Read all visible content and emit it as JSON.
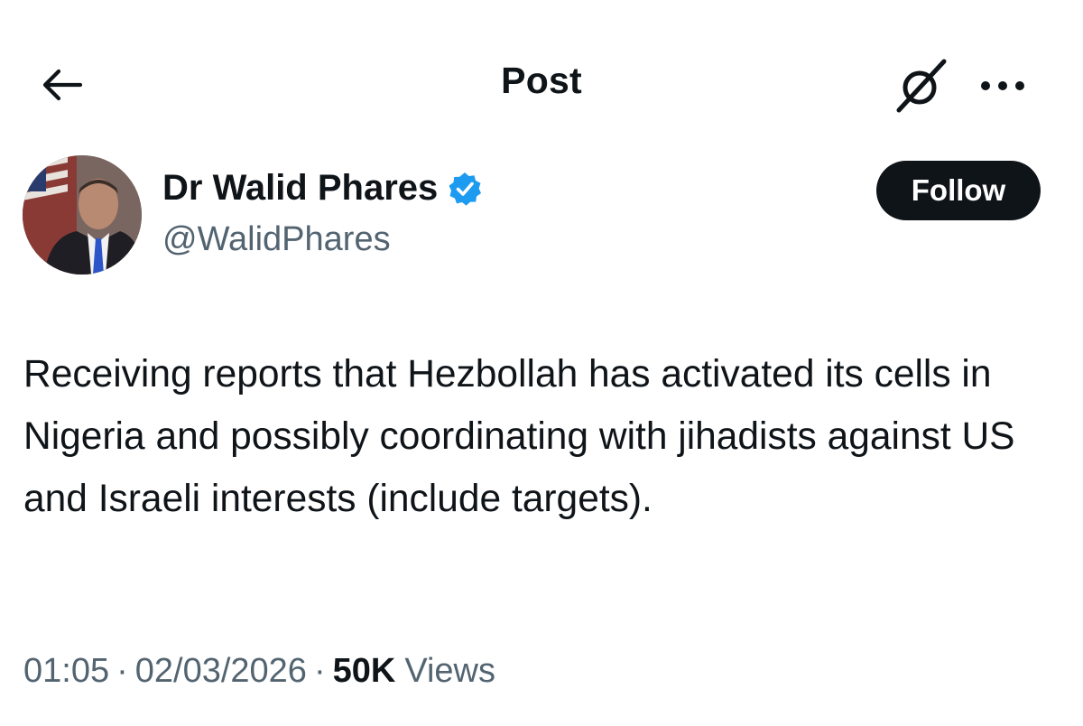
{
  "header": {
    "title": "Post",
    "icons": [
      "back-arrow-icon",
      "grok-icon",
      "more-horizontal-icon"
    ]
  },
  "author": {
    "name": "Dr Walid Phares",
    "handle": "@WalidPhares",
    "verified": true,
    "verified_color": "#1d9bf0"
  },
  "follow_button": {
    "label": "Follow"
  },
  "post": {
    "text": "Receiving reports that Hezbollah has activated its cells in Nigeria and possibly coordinating with jihadists against US and Israeli interests (include targets)."
  },
  "meta": {
    "time": "01:05",
    "date": "02/03/2026",
    "views_count": "50K",
    "views_label": "Views",
    "separator": "·"
  },
  "colors": {
    "text_primary": "#0f1419",
    "text_secondary": "#536471",
    "button_bg": "#0f1419"
  }
}
